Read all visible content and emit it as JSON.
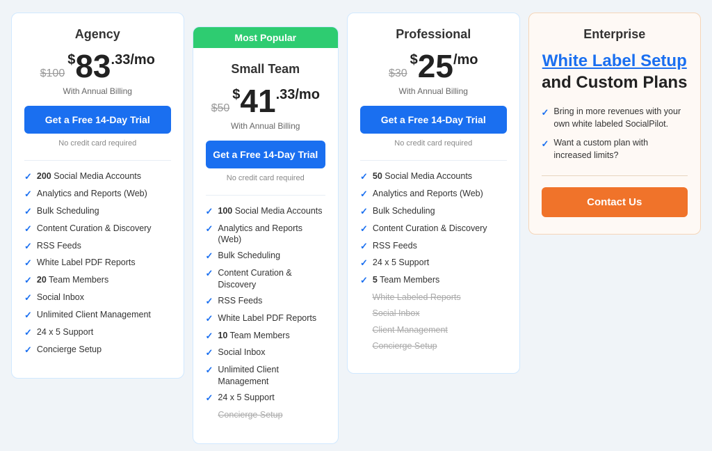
{
  "plans": [
    {
      "id": "agency",
      "title": "Agency",
      "original_price": "$100",
      "price_dollar": "$",
      "price_number": "83",
      "price_decimal": ".33/mo",
      "billing_note": "With Annual Billing",
      "trial_btn": "Get a Free 14-Day Trial",
      "no_cc": "No credit card required",
      "features": [
        {
          "text": "200",
          "suffix": " Social Media Accounts",
          "bold": true,
          "disabled": false
        },
        {
          "text": "Analytics and Reports (Web)",
          "bold": false,
          "disabled": false
        },
        {
          "text": "Bulk Scheduling",
          "bold": false,
          "disabled": false
        },
        {
          "text": "Content Curation & Discovery",
          "bold": false,
          "disabled": false
        },
        {
          "text": "RSS Feeds",
          "bold": false,
          "disabled": false
        },
        {
          "text": "White Label PDF Reports",
          "bold": false,
          "disabled": false
        },
        {
          "text": "20",
          "suffix": " Team Members",
          "bold": true,
          "disabled": false
        },
        {
          "text": "Social Inbox",
          "bold": false,
          "disabled": false
        },
        {
          "text": "Unlimited Client Management",
          "bold": false,
          "disabled": false
        },
        {
          "text": "24 x 5 Support",
          "bold": false,
          "disabled": false
        },
        {
          "text": "Concierge Setup",
          "bold": false,
          "disabled": false
        }
      ]
    },
    {
      "id": "small-team",
      "title": "Small Team",
      "original_price": "$50",
      "price_dollar": "$",
      "price_number": "41",
      "price_decimal": ".33/mo",
      "billing_note": "With Annual Billing",
      "trial_btn": "Get a Free 14-Day Trial",
      "no_cc": "No credit card required",
      "popular": true,
      "popular_label": "Most Popular",
      "features": [
        {
          "text": "100",
          "suffix": " Social Media Accounts",
          "bold": true,
          "disabled": false
        },
        {
          "text": "Analytics and Reports (Web)",
          "bold": false,
          "disabled": false
        },
        {
          "text": "Bulk Scheduling",
          "bold": false,
          "disabled": false
        },
        {
          "text": "Content Curation & Discovery",
          "bold": false,
          "disabled": false
        },
        {
          "text": "RSS Feeds",
          "bold": false,
          "disabled": false
        },
        {
          "text": "White Label PDF Reports",
          "bold": false,
          "disabled": false
        },
        {
          "text": "10",
          "suffix": " Team Members",
          "bold": true,
          "disabled": false
        },
        {
          "text": "Social Inbox",
          "bold": false,
          "disabled": false
        },
        {
          "text": "Unlimited Client Management",
          "bold": false,
          "disabled": false
        },
        {
          "text": "24 x 5 Support",
          "bold": false,
          "disabled": false
        },
        {
          "text": "Concierge Setup",
          "bold": false,
          "disabled": true
        }
      ]
    },
    {
      "id": "professional",
      "title": "Professional",
      "original_price": "$30",
      "price_dollar": "$",
      "price_number": "25",
      "price_decimal": "/mo",
      "billing_note": "With Annual Billing",
      "trial_btn": "Get a Free 14-Day Trial",
      "no_cc": "No credit card required",
      "features": [
        {
          "text": "50",
          "suffix": " Social Media Accounts",
          "bold": true,
          "disabled": false
        },
        {
          "text": "Analytics and Reports (Web)",
          "bold": false,
          "disabled": false
        },
        {
          "text": "Bulk Scheduling",
          "bold": false,
          "disabled": false
        },
        {
          "text": "Content Curation & Discovery",
          "bold": false,
          "disabled": false
        },
        {
          "text": "RSS Feeds",
          "bold": false,
          "disabled": false
        },
        {
          "text": "24 x 5 Support",
          "bold": false,
          "disabled": false
        },
        {
          "text": "5",
          "suffix": " Team Members",
          "bold": true,
          "disabled": false
        },
        {
          "text": "White Labeled Reports",
          "bold": false,
          "disabled": true
        },
        {
          "text": "Social Inbox",
          "bold": false,
          "disabled": true
        },
        {
          "text": "Client Management",
          "bold": false,
          "disabled": true
        },
        {
          "text": "Concierge Setup",
          "bold": false,
          "disabled": true
        }
      ]
    }
  ],
  "enterprise": {
    "title": "Enterprise",
    "heading_blue": "White Label Setup",
    "heading_black": "and Custom Plans",
    "features": [
      "Bring in more revenues with your own white labeled SocialPilot.",
      "Want a custom plan with increased limits?"
    ],
    "contact_btn": "Contact Us"
  },
  "colors": {
    "primary_blue": "#1a6ff0",
    "green": "#2ecc71",
    "orange": "#f0732a"
  }
}
